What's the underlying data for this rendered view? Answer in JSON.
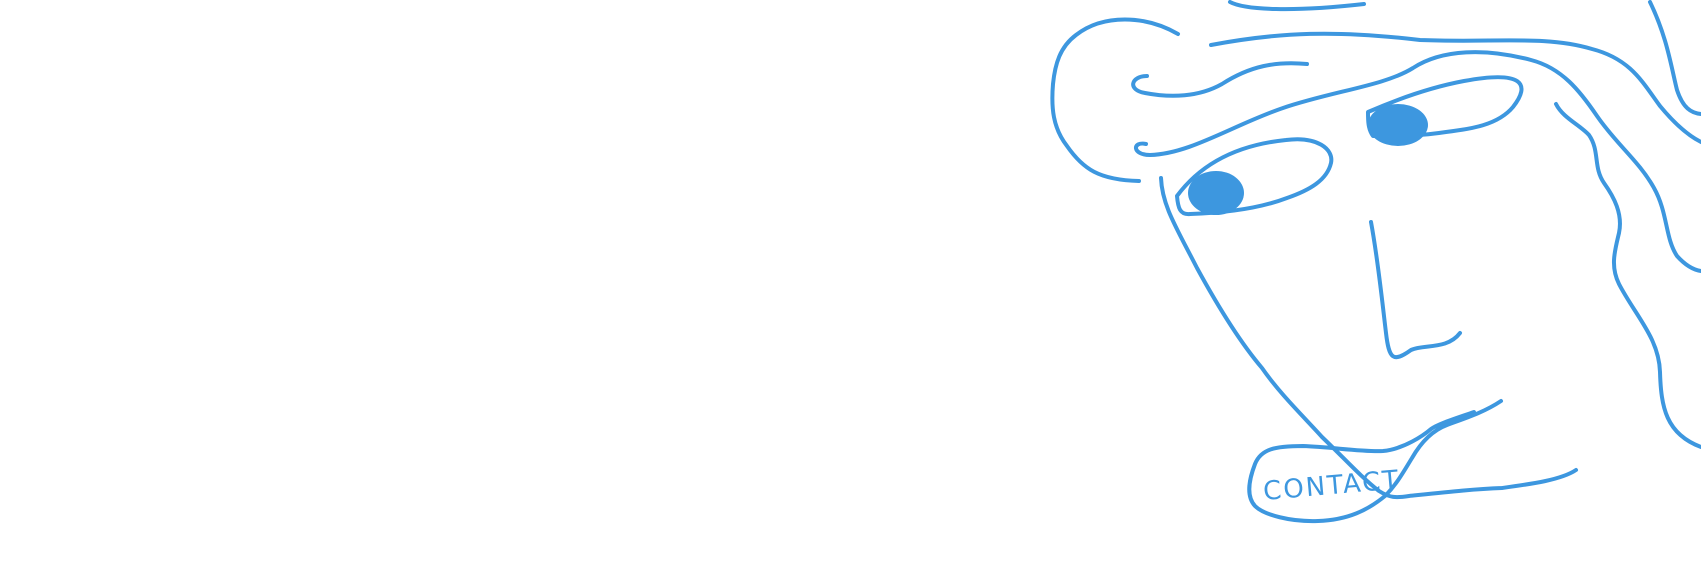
{
  "page": {
    "background_color": "#ffffff"
  },
  "illustration": {
    "line_color": "#3d97df",
    "contact_label": "CONTACT"
  }
}
